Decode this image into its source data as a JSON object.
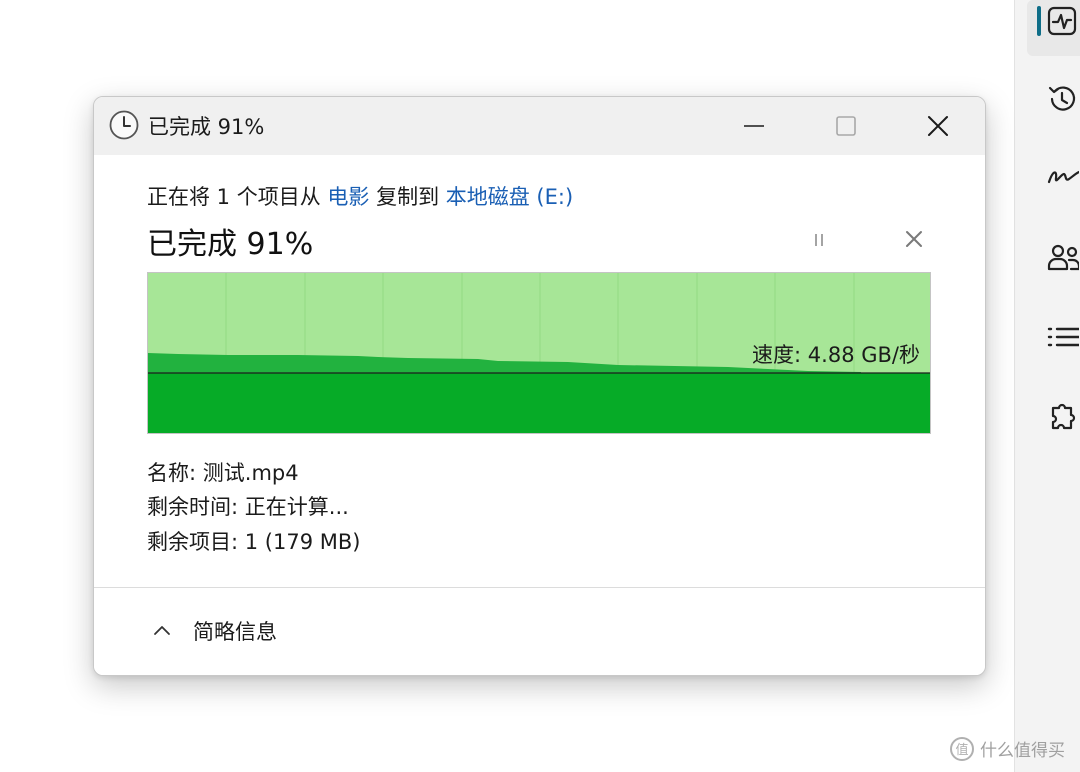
{
  "window": {
    "title": "已完成 91%"
  },
  "copy": {
    "prefix": "正在将 1 个项目从 ",
    "source": "电影",
    "middle": " 复制到 ",
    "destination": "本地磁盘 (E:)",
    "status": "已完成 91%",
    "progress_percent": 91,
    "speed_label": "速度: 4.88 GB/秒"
  },
  "details": {
    "name_label": "名称:",
    "name_value": "测试.mp4",
    "remaining_time_label": "剩余时间:",
    "remaining_time_value": "正在计算...",
    "remaining_items_label": "剩余项目:",
    "remaining_items_value": "1 (179 MB)"
  },
  "footer": {
    "toggle_label": "简略信息"
  },
  "watermark": {
    "logo_text": "值",
    "text": "什么值得买"
  },
  "colors": {
    "graph_remaining": "#a7e697",
    "graph_done": "#06ab27",
    "graph_history": "#22b23f",
    "link": "#1a5fb4",
    "titlebar": "#f0f0f0",
    "side_indicator": "#0f6e88"
  },
  "icons": {
    "title": "clock-icon",
    "minimize": "minimize-icon",
    "maximize": "maximize-icon",
    "close": "close-icon",
    "pause": "pause-icon",
    "cancel": "cancel-icon",
    "toggle": "chevron-up-icon",
    "side": [
      "activity-icon",
      "history-icon",
      "signature-icon",
      "users-icon",
      "list-icon",
      "puzzle-icon"
    ]
  }
}
